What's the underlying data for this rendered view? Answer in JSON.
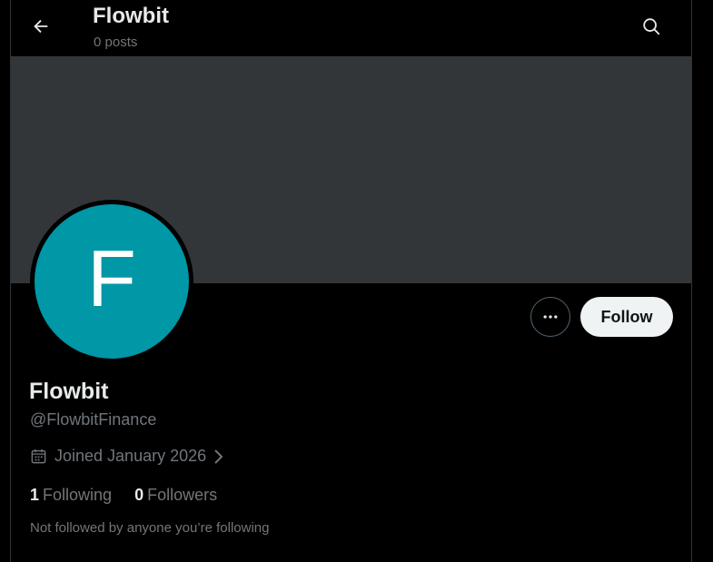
{
  "header": {
    "title": "Flowbit",
    "subtitle": "0 posts"
  },
  "profile": {
    "avatar_letter": "F",
    "display_name": "Flowbit",
    "handle": "@FlowbitFinance",
    "joined": "Joined January 2026",
    "not_followed_text": "Not followed by anyone you’re following"
  },
  "actions": {
    "follow_label": "Follow"
  },
  "stats": {
    "following_count": "1",
    "following_label": "Following",
    "followers_count": "0",
    "followers_label": "Followers"
  },
  "icons": {
    "back": "arrow-left-icon",
    "search": "search-icon",
    "more": "more-horizontal-icon",
    "calendar": "calendar-icon",
    "chevron": "chevron-right-icon"
  },
  "colors": {
    "background": "#000000",
    "banner": "#333639",
    "avatar": "#0097a7",
    "follow_button": "#eff3f4",
    "secondary_text": "#71767b"
  }
}
